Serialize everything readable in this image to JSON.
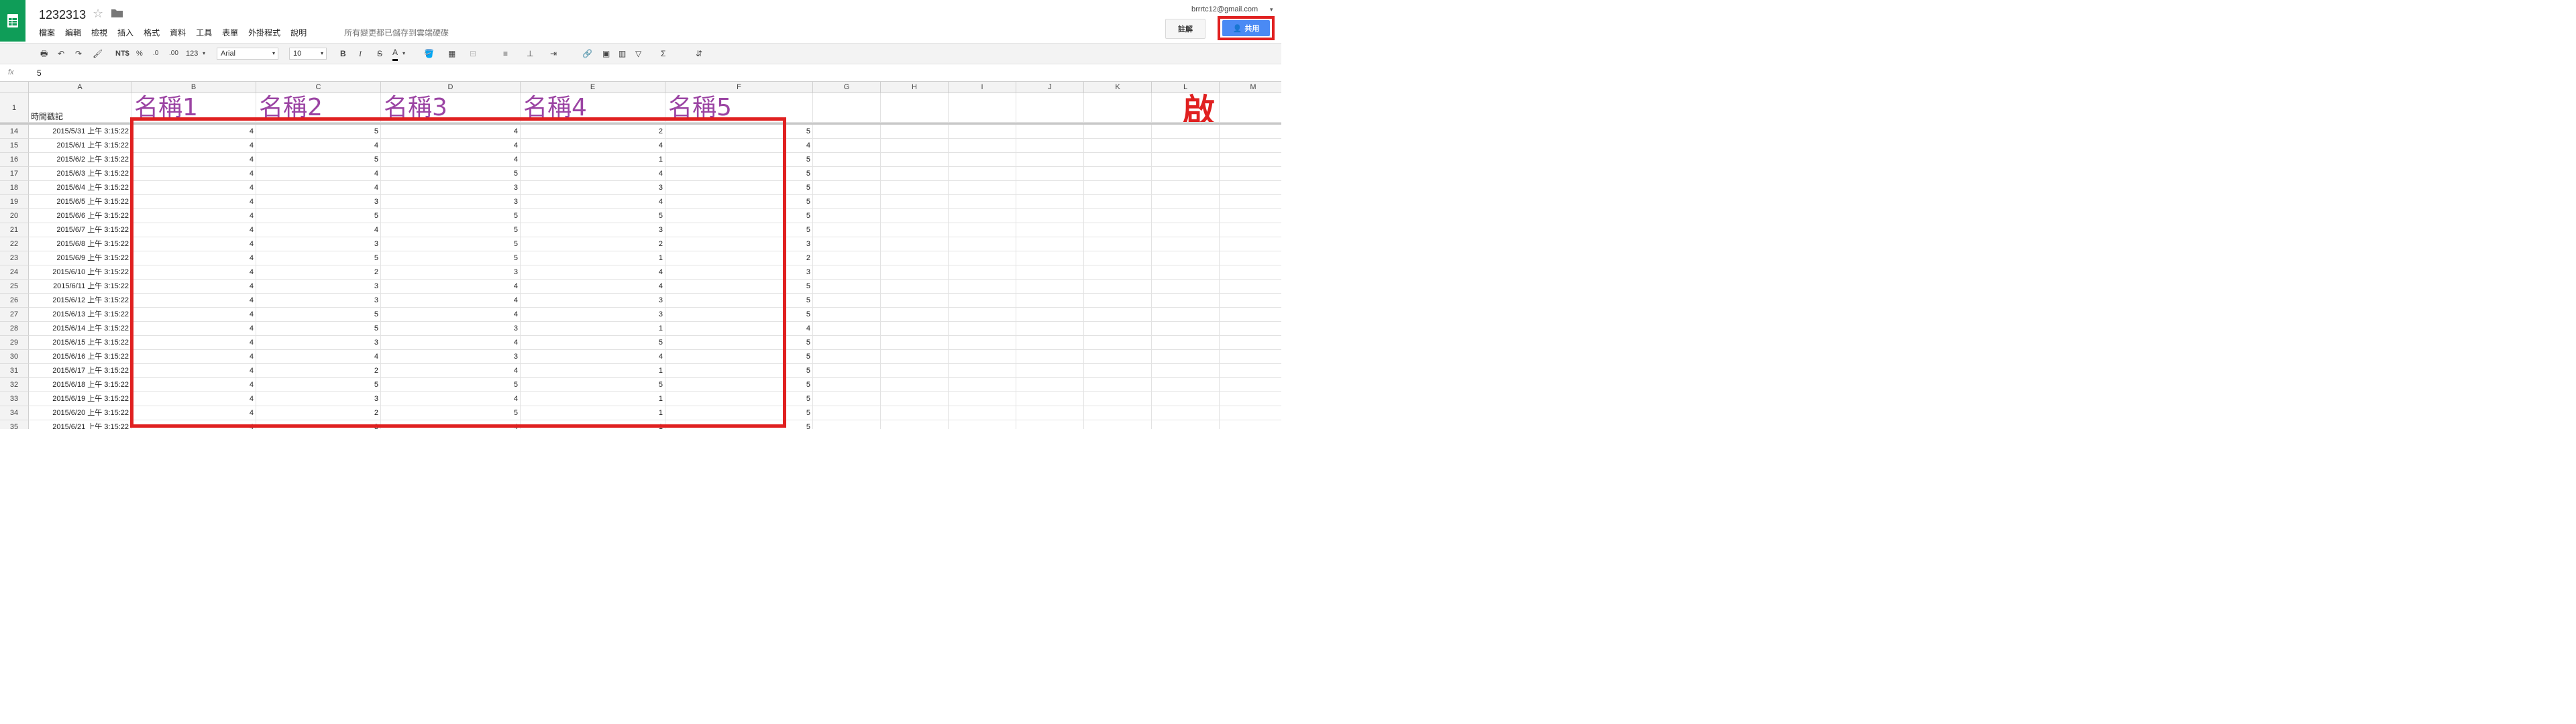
{
  "header": {
    "title": "1232313",
    "save_status": "所有變更都已儲存到雲端硬碟",
    "account_email": "brrrtc12@gmail.com",
    "comments_label": "註解",
    "share_label": "共用",
    "annotation": "必開啟"
  },
  "menu": [
    "檔案",
    "編輯",
    "檢視",
    "插入",
    "格式",
    "資料",
    "工具",
    "表單",
    "外掛程式",
    "說明"
  ],
  "toolbar": {
    "currency": "NT$",
    "percent": "%",
    "decimal_less": ".0",
    "decimal_more": ".00",
    "number_format": "123",
    "font": "Arial",
    "font_size": "10",
    "bold": "B",
    "italic": "I",
    "strike": "S",
    "text_color": "A",
    "sum": "Σ"
  },
  "formula_bar": {
    "fx": "fx",
    "value": "5"
  },
  "columns": [
    "A",
    "B",
    "C",
    "D",
    "E",
    "F",
    "G",
    "H",
    "I",
    "J",
    "K",
    "L",
    "M"
  ],
  "header_row": {
    "number": "1",
    "timestamp": "時間戳記",
    "names": [
      "名稱1",
      "名稱2",
      "名稱3",
      "名稱4",
      "名稱5"
    ]
  },
  "rows": [
    {
      "n": "14",
      "date": "2015/5/31 上午 3:15:22",
      "v": [
        "4",
        "5",
        "4",
        "2",
        "5"
      ]
    },
    {
      "n": "15",
      "date": "2015/6/1 上午 3:15:22",
      "v": [
        "4",
        "4",
        "4",
        "4",
        "4"
      ]
    },
    {
      "n": "16",
      "date": "2015/6/2 上午 3:15:22",
      "v": [
        "4",
        "5",
        "4",
        "1",
        "5"
      ]
    },
    {
      "n": "17",
      "date": "2015/6/3 上午 3:15:22",
      "v": [
        "4",
        "4",
        "5",
        "4",
        "5"
      ]
    },
    {
      "n": "18",
      "date": "2015/6/4 上午 3:15:22",
      "v": [
        "4",
        "4",
        "3",
        "3",
        "5"
      ]
    },
    {
      "n": "19",
      "date": "2015/6/5 上午 3:15:22",
      "v": [
        "4",
        "3",
        "3",
        "4",
        "5"
      ]
    },
    {
      "n": "20",
      "date": "2015/6/6 上午 3:15:22",
      "v": [
        "4",
        "5",
        "5",
        "5",
        "5"
      ]
    },
    {
      "n": "21",
      "date": "2015/6/7 上午 3:15:22",
      "v": [
        "4",
        "4",
        "5",
        "3",
        "5"
      ]
    },
    {
      "n": "22",
      "date": "2015/6/8 上午 3:15:22",
      "v": [
        "4",
        "3",
        "5",
        "2",
        "3"
      ]
    },
    {
      "n": "23",
      "date": "2015/6/9 上午 3:15:22",
      "v": [
        "4",
        "5",
        "5",
        "1",
        "2"
      ]
    },
    {
      "n": "24",
      "date": "2015/6/10 上午 3:15:22",
      "v": [
        "4",
        "2",
        "3",
        "4",
        "3"
      ]
    },
    {
      "n": "25",
      "date": "2015/6/11 上午 3:15:22",
      "v": [
        "4",
        "3",
        "4",
        "4",
        "5"
      ]
    },
    {
      "n": "26",
      "date": "2015/6/12 上午 3:15:22",
      "v": [
        "4",
        "3",
        "4",
        "3",
        "5"
      ]
    },
    {
      "n": "27",
      "date": "2015/6/13 上午 3:15:22",
      "v": [
        "4",
        "5",
        "4",
        "3",
        "5"
      ]
    },
    {
      "n": "28",
      "date": "2015/6/14 上午 3:15:22",
      "v": [
        "4",
        "5",
        "3",
        "1",
        "4"
      ]
    },
    {
      "n": "29",
      "date": "2015/6/15 上午 3:15:22",
      "v": [
        "4",
        "3",
        "4",
        "5",
        "5"
      ]
    },
    {
      "n": "30",
      "date": "2015/6/16 上午 3:15:22",
      "v": [
        "4",
        "4",
        "3",
        "4",
        "5"
      ]
    },
    {
      "n": "31",
      "date": "2015/6/17 上午 3:15:22",
      "v": [
        "4",
        "2",
        "4",
        "1",
        "5"
      ]
    },
    {
      "n": "32",
      "date": "2015/6/18 上午 3:15:22",
      "v": [
        "4",
        "5",
        "5",
        "5",
        "5"
      ]
    },
    {
      "n": "33",
      "date": "2015/6/19 上午 3:15:22",
      "v": [
        "4",
        "3",
        "4",
        "1",
        "5"
      ]
    },
    {
      "n": "34",
      "date": "2015/6/20 上午 3:15:22",
      "v": [
        "4",
        "2",
        "5",
        "1",
        "5"
      ]
    },
    {
      "n": "35",
      "date": "2015/6/21 上午 3:15:22",
      "v": [
        "4",
        "3",
        "4",
        "1",
        "5"
      ]
    }
  ],
  "colors": {
    "brand_green": "#0f9d58",
    "share_blue": "#4a8af4",
    "annotation_red": "#e02020",
    "header_purple": "#9b44a3"
  }
}
